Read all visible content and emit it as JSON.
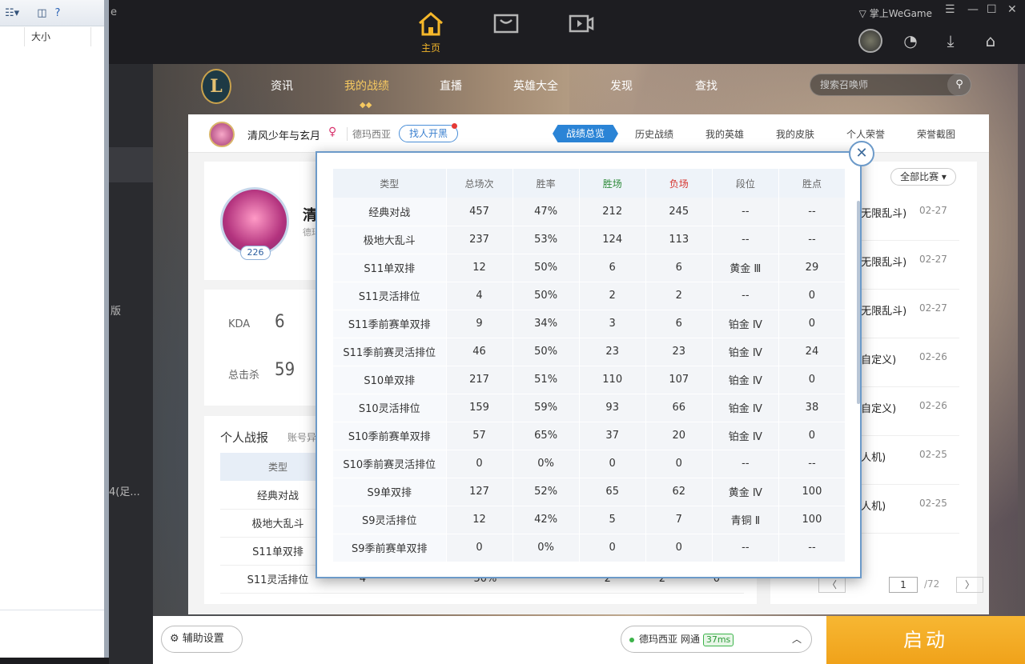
{
  "explorer": {
    "col_size": "大小"
  },
  "left_panel": {
    "text1": "版",
    "text2": "4(足..."
  },
  "topbar": {
    "left_text": "e",
    "home_label": "主页",
    "brand": "掌上WeGame"
  },
  "game_nav": {
    "logo": "L",
    "items": [
      "资讯",
      "我的战绩",
      "直播",
      "英雄大全",
      "发现",
      "查找"
    ],
    "search_placeholder": "搜索召唤师"
  },
  "profile": {
    "name": "清风少年与玄月",
    "gender_symbol": "♀",
    "server": "德玛西亚",
    "duo_button": "找人开黑",
    "tabs": [
      "战绩总览",
      "历史战绩",
      "我的英雄",
      "我的皮肤",
      "个人荣誉",
      "荣誉截图"
    ],
    "level": "226",
    "big_name": "清",
    "big_sub": "德玛"
  },
  "stats": {
    "kda_label": "KDA",
    "kda_value": "6",
    "kills_label": "总击杀",
    "kills_value": "59"
  },
  "report": {
    "title": "个人战报",
    "account_label": "账号异",
    "header": "类型",
    "rows": [
      [
        "经典对战",
        "",
        "",
        "",
        "",
        "",
        ""
      ],
      [
        "极地大乱斗",
        "",
        "",
        "",
        "",
        "",
        ""
      ],
      [
        "S11单双排",
        "",
        "",
        "",
        "",
        "",
        ""
      ],
      [
        "S11灵活排位",
        "4",
        "50%",
        "2",
        "2",
        "",
        "0"
      ]
    ]
  },
  "history": {
    "filter": "全部比赛",
    "filter_chevron": "▾",
    "matches": [
      {
        "type": "(无限乱斗)",
        "date": "02-27"
      },
      {
        "type": "(无限乱斗)",
        "date": "02-27"
      },
      {
        "type": "(无限乱斗)",
        "date": "02-27"
      },
      {
        "type": "(自定义)",
        "date": "02-26"
      },
      {
        "type": "(自定义)",
        "date": "02-26"
      },
      {
        "type": "(人机)",
        "date": "02-25"
      },
      {
        "type": "(人机)",
        "date": "02-25"
      }
    ],
    "prev": "〈",
    "page": "1",
    "total": "/72",
    "next": "〉"
  },
  "bottom": {
    "assist": "辅助设置",
    "server": "德玛西亚 网通",
    "ping": "37ms",
    "launch": "启动"
  },
  "modal": {
    "close": "✕",
    "headers": [
      "类型",
      "总场次",
      "胜率",
      "胜场",
      "负场",
      "段位",
      "胜点"
    ],
    "rows": [
      [
        "经典对战",
        "457",
        "47%",
        "212",
        "245",
        "--",
        "--"
      ],
      [
        "极地大乱斗",
        "237",
        "53%",
        "124",
        "113",
        "--",
        "--"
      ],
      [
        "S11单双排",
        "12",
        "50%",
        "6",
        "6",
        "黄金 Ⅲ",
        "29"
      ],
      [
        "S11灵活排位",
        "4",
        "50%",
        "2",
        "2",
        "--",
        "0"
      ],
      [
        "S11季前赛单双排",
        "9",
        "34%",
        "3",
        "6",
        "铂金 Ⅳ",
        "0"
      ],
      [
        "S11季前赛灵活排位",
        "46",
        "50%",
        "23",
        "23",
        "铂金 Ⅳ",
        "24"
      ],
      [
        "S10单双排",
        "217",
        "51%",
        "110",
        "107",
        "铂金 Ⅳ",
        "0"
      ],
      [
        "S10灵活排位",
        "159",
        "59%",
        "93",
        "66",
        "铂金 Ⅳ",
        "38"
      ],
      [
        "S10季前赛单双排",
        "57",
        "65%",
        "37",
        "20",
        "铂金 Ⅳ",
        "0"
      ],
      [
        "S10季前赛灵活排位",
        "0",
        "0%",
        "0",
        "0",
        "--",
        "--"
      ],
      [
        "S9单双排",
        "127",
        "52%",
        "65",
        "62",
        "黄金 Ⅳ",
        "100"
      ],
      [
        "S9灵活排位",
        "12",
        "42%",
        "5",
        "7",
        "青铜 Ⅱ",
        "100"
      ],
      [
        "S9季前赛单双排",
        "0",
        "0%",
        "0",
        "0",
        "--",
        "--"
      ]
    ]
  }
}
